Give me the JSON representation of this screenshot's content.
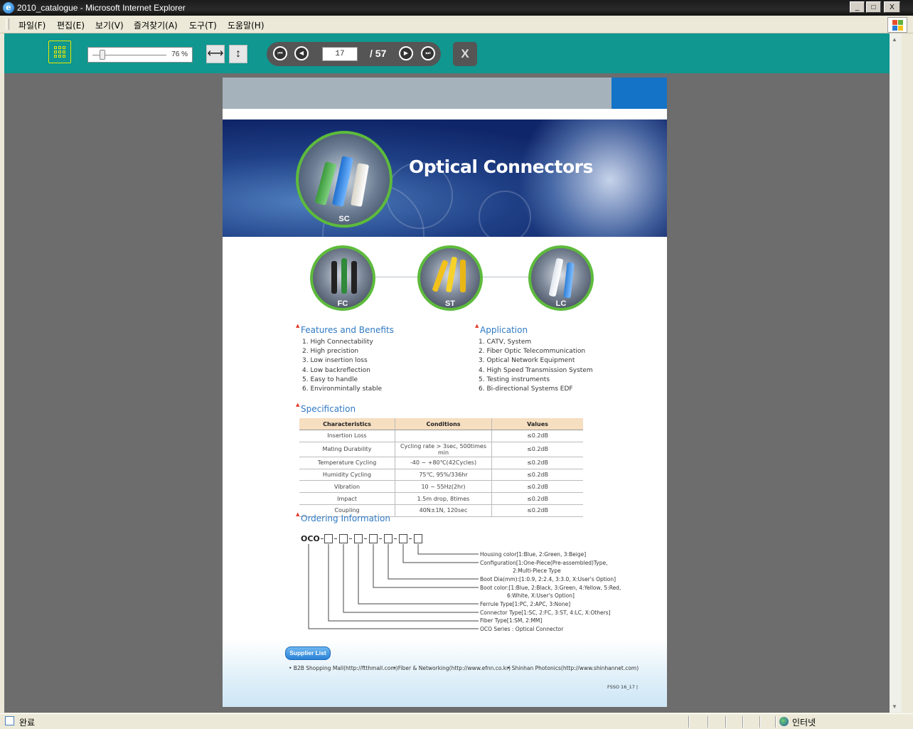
{
  "window": {
    "title": "2010_catalogue - Microsoft Internet Explorer",
    "minimize": "_",
    "maximize": "□",
    "close": "X"
  },
  "menu": {
    "items": [
      "파일(F)",
      "편집(E)",
      "보기(V)",
      "즐겨찾기(A)",
      "도구(T)",
      "도움말(H)"
    ]
  },
  "viewer": {
    "zoom_label": "76 %",
    "zoom_level_percent": 76,
    "fit_width_icon": "⟷",
    "fit_height_icon": "↕",
    "first_icon": "⏮",
    "prev_icon": "◀",
    "next_icon": "▶",
    "last_icon": "⏭",
    "current_page": "17",
    "total_pages": "/ 57",
    "close_label": "X"
  },
  "catalog": {
    "hero_title": "Optical Connectors",
    "connector_labels": {
      "sc": "SC",
      "fc": "FC",
      "st": "ST",
      "lc": "LC"
    },
    "features": {
      "heading": "Features and Benefits",
      "items": [
        "1. High Connectability",
        "2. High precistion",
        "3. Low insertion loss",
        "4. Low backreflection",
        "5. Easy to handle",
        "6. Environmintally stable"
      ]
    },
    "application": {
      "heading": "Application",
      "items": [
        "1. CATV, System",
        "2. Fiber Optic Telecommunication",
        "3. Optical Network Equipment",
        "4. High Speed Transmission System",
        "5. Testing instruments",
        "6. Bi-directional Systems EDF"
      ]
    },
    "specification": {
      "heading": "Specification",
      "columns": [
        "Characteristics",
        "Conditions",
        "Values"
      ],
      "rows": [
        [
          "Insertion Loss",
          "",
          "≤0.2dB"
        ],
        [
          "Mating Durability",
          "Cycling rate > 3sec, 500times min",
          "≤0.2dB"
        ],
        [
          "Temperature Cycling",
          "-40 ~ +80℃(42Cycles)",
          "≤0.2dB"
        ],
        [
          "Humidity Cycling",
          "75℃, 95%/336hr",
          "≤0.2dB"
        ],
        [
          "Vibration",
          "10 ~ 55Hz(2hr)",
          "≤0.2dB"
        ],
        [
          "Impact",
          "1.5m drop, 8times",
          "≤0.2dB"
        ],
        [
          "Coupling",
          "40N±1N, 120sec",
          "≤0.2dB"
        ]
      ]
    },
    "ordering": {
      "heading": "Ordering Information",
      "code_prefix": "OCO",
      "legend": [
        "Housing color[1:Blue, 2:Green, 3:Beige]",
        "Configuration[1:One-Piece(Pre-assembled)Type,",
        "2:Multi-Piece Type",
        "Boot Dia(mm):[1:0.9, 2:2.4, 3:3.0, X:User's Option]",
        "Boot color:[1:Blue, 2:Black, 3:Green, 4:Yellow, 5:Red,",
        "6:White, X:User's Option]",
        "Ferrule Type[1:PC, 2:APC, 3:None]",
        "Connector  Type[1:SC, 2:FC, 3:ST, 4:LC, X:Others]",
        "Fiber  Type[1:SM, 2:MM]",
        "OCO Series : Optical Connector"
      ]
    },
    "supplier": {
      "label": "Supplier List",
      "links": [
        "• B2B Shopping Mall(http://ftthmall.com)",
        "• Fiber & Networking(http://www.efnn.co.kr)",
        "• Shinhan Photonics(http://www.shinhannet.com)"
      ]
    },
    "page_footer": "FSSO  16_17 |"
  },
  "status": {
    "text": "완료",
    "zone": "인터넷"
  }
}
